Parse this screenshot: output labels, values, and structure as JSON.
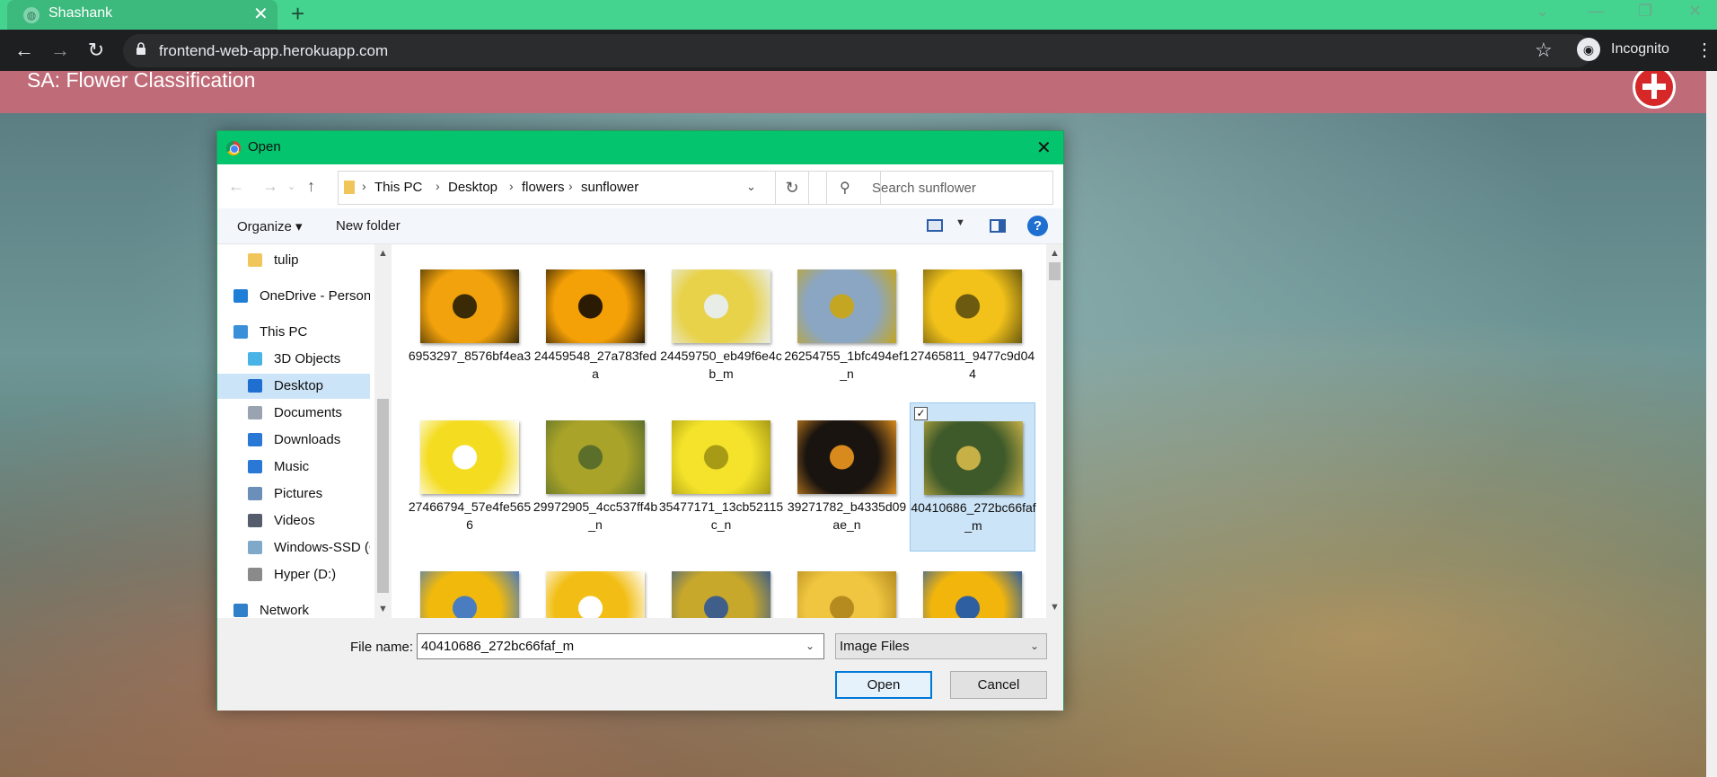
{
  "browser": {
    "tab_title": "Shashank",
    "tab_close": "✕",
    "new_tab": "+",
    "window_controls": [
      "⌄",
      "—",
      "❐",
      "✕"
    ],
    "url": "frontend-web-app.herokuapp.com",
    "incognito_label": "Incognito",
    "icons": [
      "back-icon",
      "forward-icon",
      "reload-icon",
      "lock-icon",
      "star-icon",
      "incognito-icon",
      "menu-icon"
    ]
  },
  "page": {
    "title": "SA: Flower Classification"
  },
  "dialog": {
    "title": "Open",
    "close": "✕",
    "breadcrumb": [
      "This PC",
      "Desktop",
      "flowers",
      "sunflower"
    ],
    "search_placeholder": "Search sunflower",
    "organize": "Organize ▾",
    "new_folder": "New folder",
    "help": "?",
    "nav_items": [
      {
        "label": "tulip",
        "icon": "folder-icon",
        "color": "#f0c65a"
      },
      {
        "label": "OneDrive - Person",
        "icon": "onedrive-icon",
        "color": "#1f7fd6"
      },
      {
        "label": "This PC",
        "icon": "computer-icon",
        "color": "#3a8fd9"
      },
      {
        "label": "3D Objects",
        "icon": "3d-objects-icon",
        "color": "#49b3e6"
      },
      {
        "label": "Desktop",
        "icon": "desktop-icon",
        "color": "#1f6fd1"
      },
      {
        "label": "Documents",
        "icon": "documents-icon",
        "color": "#9aa4b1"
      },
      {
        "label": "Downloads",
        "icon": "downloads-icon",
        "color": "#2a78d6"
      },
      {
        "label": "Music",
        "icon": "music-icon",
        "color": "#2a78d6"
      },
      {
        "label": "Pictures",
        "icon": "pictures-icon",
        "color": "#6b8fb8"
      },
      {
        "label": "Videos",
        "icon": "videos-icon",
        "color": "#555c6b"
      },
      {
        "label": "Windows-SSD (C",
        "icon": "drive-icon",
        "color": "#7fa8c9"
      },
      {
        "label": "Hyper (D:)",
        "icon": "drive-icon",
        "color": "#8a8a8a"
      },
      {
        "label": "Network",
        "icon": "network-icon",
        "color": "#2f7fc9"
      }
    ],
    "files": [
      {
        "name": "6953297_8576bf4ea3",
        "colors": [
          "#f2a20c",
          "#3a2a06"
        ]
      },
      {
        "name": "24459548_27a783feda",
        "colors": [
          "#f4a007",
          "#2b1a04"
        ]
      },
      {
        "name": "24459750_eb49f6e4cb_m",
        "colors": [
          "#e8d24a",
          "#e9ede7"
        ]
      },
      {
        "name": "26254755_1bfc494ef1_n",
        "colors": [
          "#8ba6c2",
          "#c4a622"
        ]
      },
      {
        "name": "27465811_9477c9d044",
        "colors": [
          "#f2c21a",
          "#6b5a10"
        ]
      },
      {
        "name": "27466794_57e4fe5656",
        "colors": [
          "#f4dc21",
          "#ffffff"
        ]
      },
      {
        "name": "29972905_4cc537ff4b_n",
        "colors": [
          "#a9a329",
          "#5b6f2a"
        ]
      },
      {
        "name": "35477171_13cb52115c_n",
        "colors": [
          "#f4e32a",
          "#a79a15"
        ]
      },
      {
        "name": "39271782_b4335d09ae_n",
        "colors": [
          "#1a1410",
          "#d98a1d"
        ]
      },
      {
        "name": "40410686_272bc66faf_m",
        "colors": [
          "#3f5a2a",
          "#c7b046"
        ],
        "selected": true
      },
      {
        "name": "",
        "colors": [
          "#f0b90c",
          "#4a7cc0"
        ]
      },
      {
        "name": "",
        "colors": [
          "#f2be15",
          "#ffffff"
        ]
      },
      {
        "name": "",
        "colors": [
          "#c8a82a",
          "#3f5f8a"
        ]
      },
      {
        "name": "",
        "colors": [
          "#f0c640",
          "#b58b20"
        ]
      },
      {
        "name": "",
        "colors": [
          "#f2b50c",
          "#2e5fa0"
        ]
      }
    ],
    "file_name_label": "File name:",
    "file_name_value": "40410686_272bc66faf_m",
    "filter_value": "Image Files",
    "open_button": "Open",
    "cancel_button": "Cancel",
    "checkmark": "✓"
  },
  "colors": {
    "chrome_accent": "#45d390",
    "dialog_title_bg": "#04c46e",
    "page_header_bg": "#c06b78",
    "selection": "#cce4f7"
  }
}
